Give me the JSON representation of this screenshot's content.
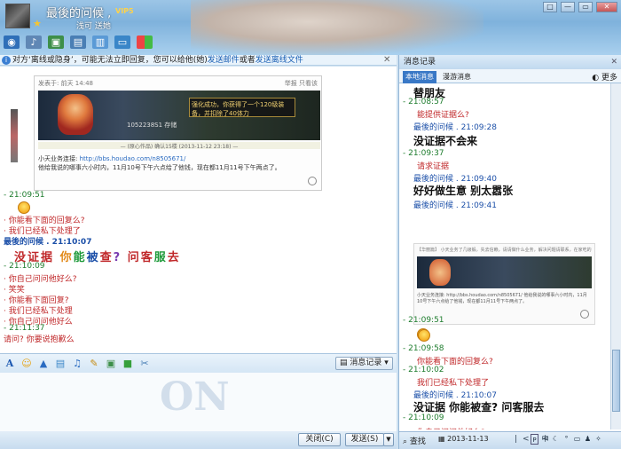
{
  "header": {
    "nickname": "最後的问候 ,",
    "vip": "VIP5",
    "status_text": "浅可 送她",
    "window_controls": [
      "□",
      "—",
      "▭",
      "✕"
    ]
  },
  "notice": {
    "prefix": "对方‘离线或隐身’，可能无法立即回复，您可以给他(她)",
    "link1": "发送邮件",
    "middle": "或者",
    "link2": "发送离线文件",
    "close": "✕"
  },
  "chat": {
    "shot": {
      "meta": "发表于: 前天 14:48",
      "actions": "举报 只看该",
      "popup": "强化成功，你获得了一个120级装备，并扣除了40体力",
      "stats": "1052238S1 存储",
      "bar": "— (原心作品) 确认15楼 (2013-11-12 23:18) —",
      "line1_label": "小天业务连接:",
      "line1_link": "http://bbs.houdao.com/n8505671/",
      "line2": "他给我说的哪事六小时内，11月10号下午六点给了他钱，现在都11月11号下午两点了。"
    },
    "messages": [
      {
        "kind": "time",
        "text": "-  21:09:51"
      },
      {
        "kind": "emoji",
        "text": ""
      },
      {
        "kind": "red",
        "text": "·  你能看下面的回复么?"
      },
      {
        "kind": "red",
        "text": "·  我们已经私下处理了"
      },
      {
        "kind": "blue",
        "text": "最後的问候  .    21:10:07"
      },
      {
        "kind": "big",
        "text": "没证据 你能被查? 问客服去"
      },
      {
        "kind": "time",
        "text": "-  21:10:09"
      },
      {
        "kind": "red",
        "text": "·  你自己问问他好么?"
      },
      {
        "kind": "red",
        "text": "·  笑笑"
      },
      {
        "kind": "red",
        "text": "·  你能看下面回复?"
      },
      {
        "kind": "red",
        "text": "·  我们已经私下处理"
      },
      {
        "kind": "red",
        "text": "·  你自己问问他好么"
      },
      {
        "kind": "time",
        "text": "-  21:11:37"
      },
      {
        "kind": "red",
        "text": "   请问?    你要说抱歉么"
      }
    ]
  },
  "format_bar": {
    "font_icon": "A",
    "history_label": "消息记录"
  },
  "input_area": {
    "watermark": "ON"
  },
  "buttons": {
    "close": "关闭(C)",
    "send": "发送(S)",
    "send_dropdown": "▼"
  },
  "right_panel": {
    "title": "消息记录",
    "close": "✕",
    "tab_local": "本地消息",
    "tab_roam": "漫游消息",
    "more": "更多",
    "messages": [
      {
        "kind": "big",
        "text": "替朋友"
      },
      {
        "kind": "time",
        "text": "- 21:08:57"
      },
      {
        "kind": "red",
        "text": "能提供证据么?"
      },
      {
        "kind": "name",
        "text": "最後的问候 . 21:09:28"
      },
      {
        "kind": "big",
        "text": "没证据不会来"
      },
      {
        "kind": "time",
        "text": "- 21:09:37"
      },
      {
        "kind": "red",
        "text": "请求证据"
      },
      {
        "kind": "name",
        "text": "最後的问候 . 21:09:40"
      },
      {
        "kind": "big",
        "text": "好好做生意  别太嚣张"
      },
      {
        "kind": "name",
        "text": "最後的问候 . 21:09:41"
      },
      {
        "kind": "time",
        "text": "- 21:09:51"
      },
      {
        "kind": "emoji",
        "text": ""
      },
      {
        "kind": "time",
        "text": "- 21:09:58"
      },
      {
        "kind": "red",
        "text": "你能看下面的回复么?"
      },
      {
        "kind": "time",
        "text": "- 21:10:02"
      },
      {
        "kind": "red",
        "text": "我们已经私下处理了"
      },
      {
        "kind": "name",
        "text": "最後的问候 . 21:10:07"
      },
      {
        "kind": "big",
        "text": "没证据 你能被查? 问客服去"
      },
      {
        "kind": "time",
        "text": "- 21:10:09"
      },
      {
        "kind": "red",
        "text": "你自己问问他好么?"
      }
    ],
    "shot": {
      "head": "【华丽篇】 小天业务了几级锻，失去信赖，请请做什么业务，解决问题请联系，在家吃的",
      "text": "小天业务连接: http://bbs.houdao.com/n8505671/ 他给我说的哪事六小时内，11月10号下午六点给了他钱，现在都11月11号下午两点了。"
    },
    "footer": {
      "search": "查找",
      "date": "2013-11-13",
      "nav": "|<  <"
    }
  }
}
